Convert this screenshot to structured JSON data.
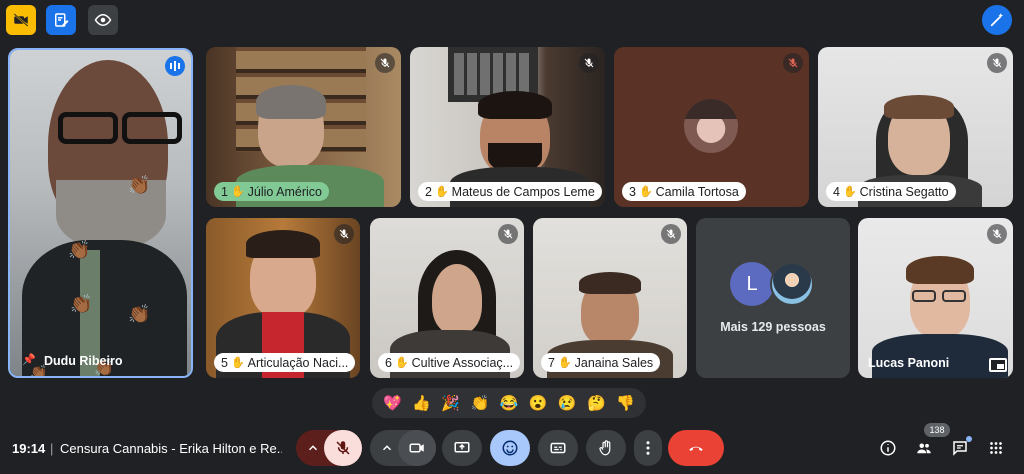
{
  "participants": [
    {
      "name": "Dudu Ribeiro"
    },
    {
      "name": "Júlio Américo",
      "order": "1"
    },
    {
      "name": "Mateus de Campos Leme",
      "order": "2"
    },
    {
      "name": "Camila Tortosa",
      "order": "3"
    },
    {
      "name": "Cristina Segatto",
      "order": "4"
    },
    {
      "name": "Articulação Naci...",
      "order": "5"
    },
    {
      "name": "Cultive Associaç...",
      "order": "6"
    },
    {
      "name": "Janaina Sales",
      "order": "7"
    },
    {
      "name": "Lucas Panoni"
    }
  ],
  "more_people": {
    "label": "Mais 129 pessoas",
    "avatar_letter": "L"
  },
  "reactions": [
    "💖",
    "👍",
    "🎉",
    "👏",
    "😂",
    "😮",
    "😢",
    "🤔",
    "👎"
  ],
  "bottom_bar": {
    "time": "19:14",
    "separator": "|",
    "meeting_title": "Censura Cannabis - Erika Hilton e Re...",
    "participant_count": "138"
  },
  "colors": {
    "background": "#202124",
    "end_call": "#ea4335",
    "active_speaker": "#8ab4f8",
    "accent": "#1a73e8"
  }
}
